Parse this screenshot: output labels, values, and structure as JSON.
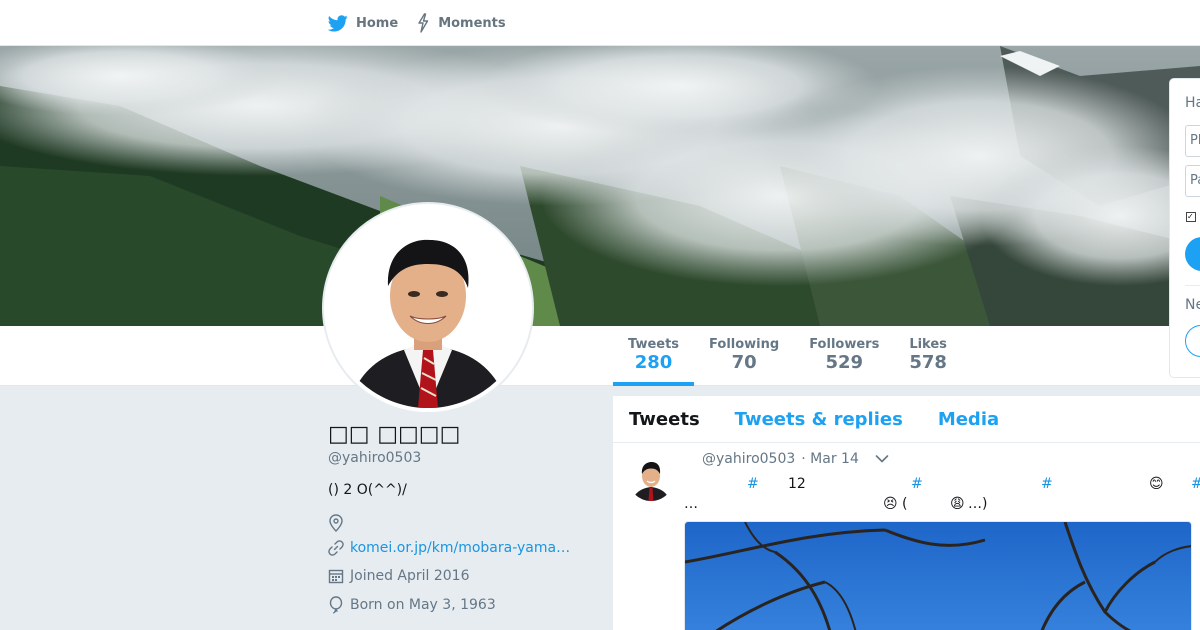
{
  "nav": {
    "home_label": "Home",
    "moments_label": "Moments",
    "brand_color": "#1da1f2"
  },
  "profile": {
    "name": "□□ □□□□",
    "handle": "@yahiro0503",
    "bio": "() 2 O(^^)/",
    "location": "",
    "website": "komei.or.jp/km/mobara-yama…",
    "joined": "Joined April 2016",
    "born": "Born on May 3, 1963"
  },
  "stats": [
    {
      "label": "Tweets",
      "value": "280"
    },
    {
      "label": "Following",
      "value": "70"
    },
    {
      "label": "Followers",
      "value": "529"
    },
    {
      "label": "Likes",
      "value": "578"
    }
  ],
  "timeline": {
    "tabs": [
      "Tweets",
      "Tweets & replies",
      "Media"
    ],
    "tweet": {
      "handle": "@yahiro0503",
      "time": "· Mar 14",
      "line1": {
        "hash1": "#",
        "num": "12",
        "hash2": "#",
        "hash3": "#",
        "emoji": "😊",
        "hash4": "#"
      },
      "line2": {
        "ellipsis": "…",
        "emoji_a": "😣",
        "paren_open": "(",
        "emoji_b": "😩",
        "paren_close": "…)"
      }
    }
  },
  "login": {
    "title": "Ha",
    "phone_placeholder": "Ph",
    "password_placeholder": "Pa",
    "new_label": "Ne"
  }
}
